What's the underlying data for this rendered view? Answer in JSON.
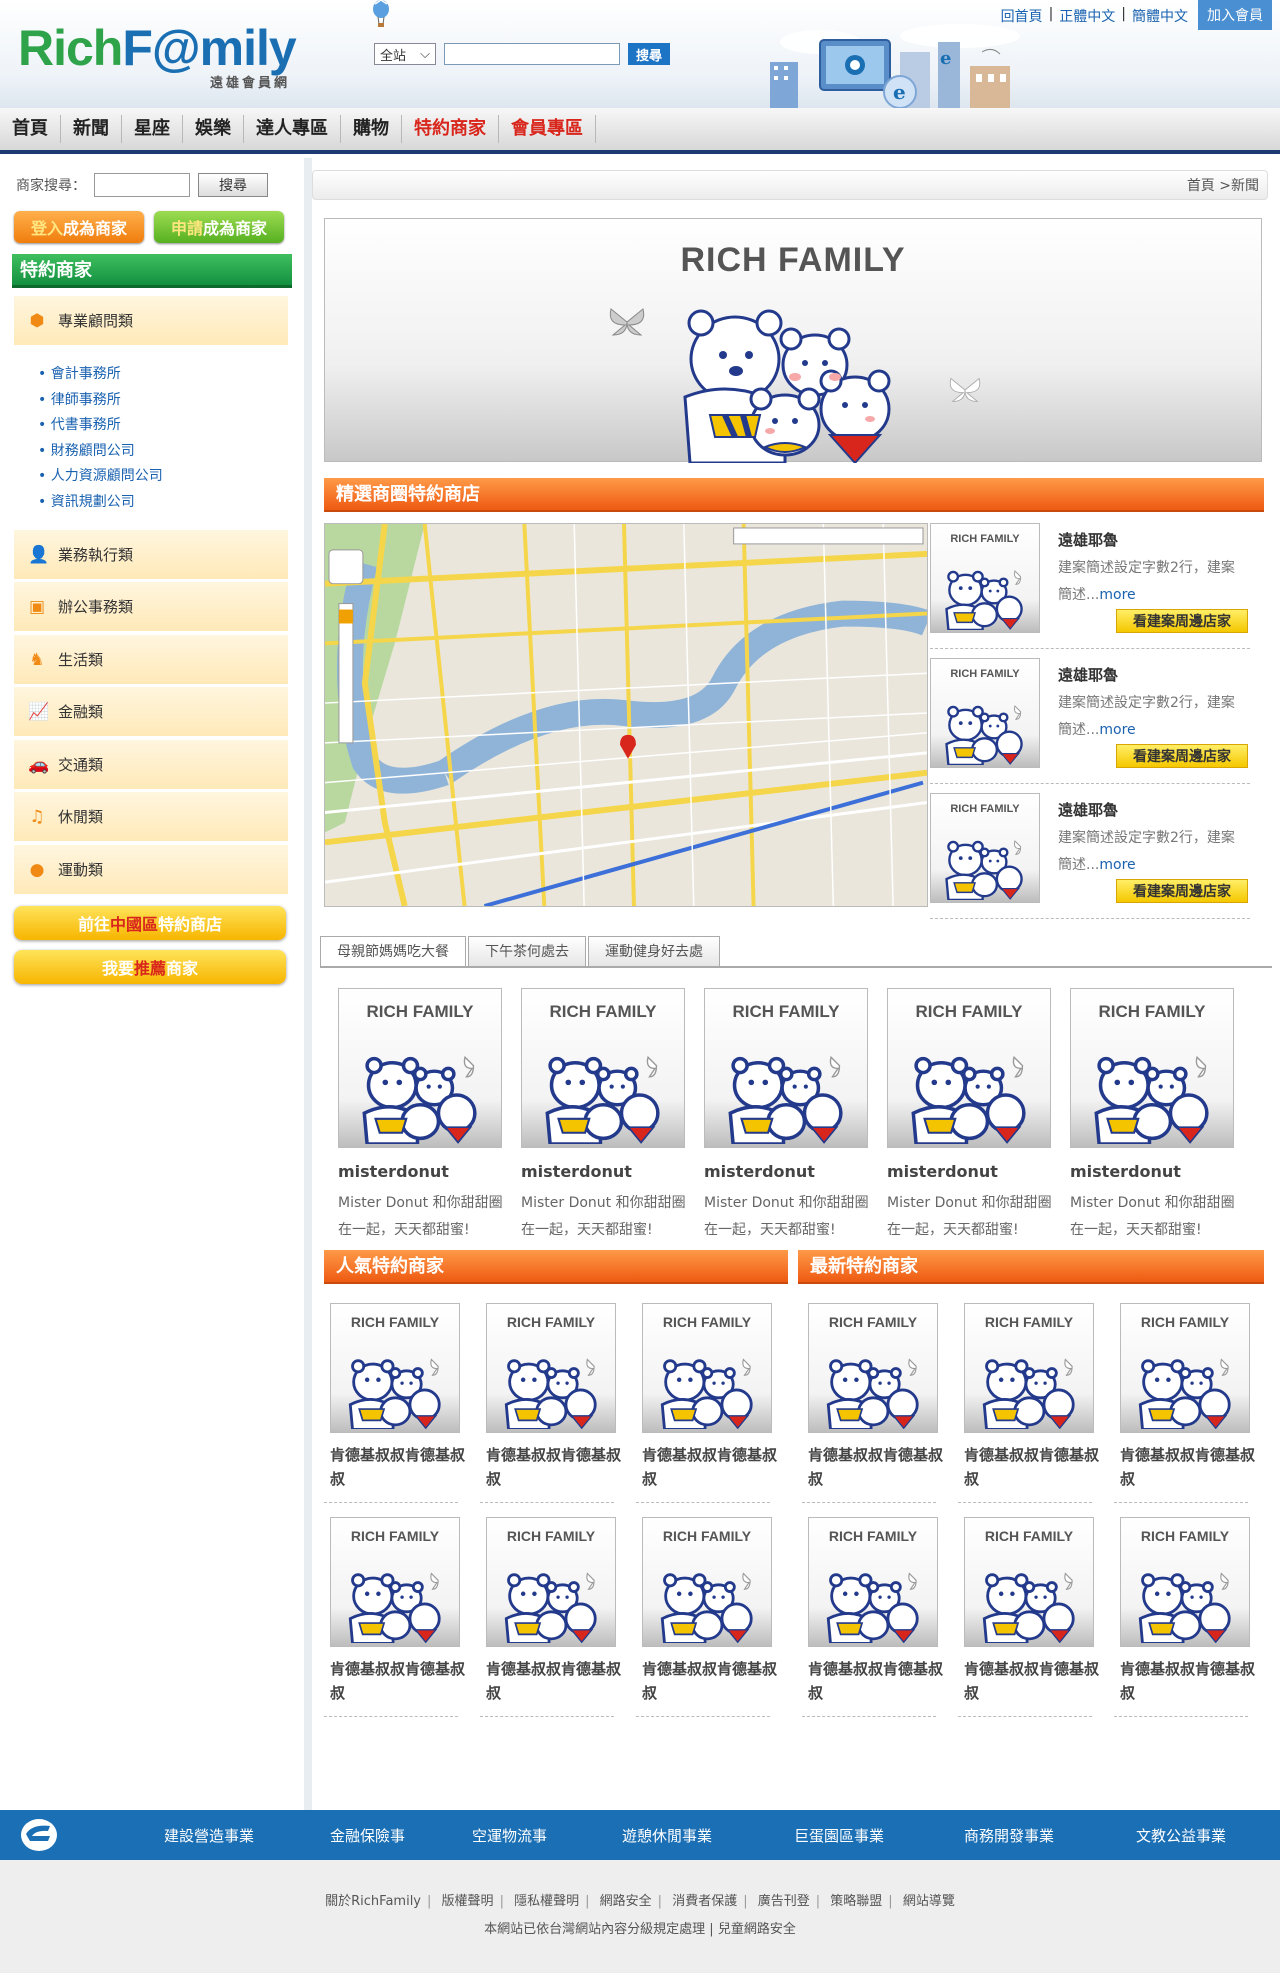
{
  "header": {
    "logo_part1": "Rich",
    "logo_part2": "F@mily",
    "logo_sub": "遠雄會員網",
    "site_select": "全站",
    "search_button": "搜尋",
    "top_links": [
      "回首頁",
      "正體中文",
      "簡體中文"
    ],
    "join_button": "加入會員"
  },
  "nav": {
    "items": [
      {
        "label": "首頁",
        "highlight": false
      },
      {
        "label": "新聞",
        "highlight": false
      },
      {
        "label": "星座",
        "highlight": false
      },
      {
        "label": "娛樂",
        "highlight": false
      },
      {
        "label": "達人專區",
        "highlight": false
      },
      {
        "label": "購物",
        "highlight": false
      },
      {
        "label": "特約商家",
        "highlight": true
      },
      {
        "label": "會員專區",
        "highlight": true
      }
    ]
  },
  "sidebar": {
    "search_label": "商家搜尋：",
    "search_button": "搜尋",
    "login_cta": {
      "hl": "登入",
      "rest": "成為商家"
    },
    "apply_cta": {
      "hl": "申請",
      "rest": "成為商家"
    },
    "title": "特約商家",
    "categories": [
      {
        "label": "專業顧問類",
        "icon": "cube-icon"
      },
      {
        "label": "業務執行類",
        "icon": "person-icon"
      },
      {
        "label": "辦公事務類",
        "icon": "briefcase-icon"
      },
      {
        "label": "生活類",
        "icon": "dog-icon"
      },
      {
        "label": "金融類",
        "icon": "chart-icon"
      },
      {
        "label": "交通類",
        "icon": "car-icon"
      },
      {
        "label": "休閒類",
        "icon": "music-icon"
      },
      {
        "label": "運動類",
        "icon": "ball-icon"
      }
    ],
    "sub_items": [
      "會計事務所",
      "律師事務所",
      "代書事務所",
      "財務顧問公司",
      "人力資源顧問公司",
      "資訊規劃公司"
    ],
    "china_btn": {
      "pre": "前往",
      "hl": "中國區",
      "post": "特約商店"
    },
    "recommend_btn": {
      "pre": "我要",
      "hl": "推薦",
      "post": "商家"
    }
  },
  "main": {
    "breadcrumb": "首頁 >新聞",
    "banner_title": "RICH FAMILY",
    "featured_title": "精選商圈特約商店",
    "thumb_text": "RICH FAMILY",
    "stores": [
      {
        "name": "遠雄耶魯",
        "desc": "建案簡述設定字數2行，建案簡述...",
        "more": "more",
        "button": "看建案周邊店家"
      },
      {
        "name": "遠雄耶魯",
        "desc": "建案簡述設定字數2行，建案簡述...",
        "more": "more",
        "button": "看建案周邊店家"
      },
      {
        "name": "遠雄耶魯",
        "desc": "建案簡述設定字數2行，建案簡述...",
        "more": "more",
        "button": "看建案周邊店家"
      }
    ],
    "tabs": [
      "母親節媽媽吃大餐",
      "下午茶何處去",
      "運動健身好去處"
    ],
    "products": [
      {
        "name": "misterdonut",
        "desc": "Mister Donut 和你甜甜圈 在一起，天天都甜蜜!"
      },
      {
        "name": "misterdonut",
        "desc": "Mister Donut 和你甜甜圈 在一起，天天都甜蜜!"
      },
      {
        "name": "misterdonut",
        "desc": "Mister Donut 和你甜甜圈 在一起，天天都甜蜜!"
      },
      {
        "name": "misterdonut",
        "desc": "Mister Donut 和你甜甜圈 在一起，天天都甜蜜!"
      },
      {
        "name": "misterdonut",
        "desc": "Mister Donut 和你甜甜圈 在一起，天天都甜蜜!"
      }
    ],
    "popular_title": "人氣特約商家",
    "newest_title": "最新特約商家",
    "popular_items": [
      "肯德基叔叔肯德基叔叔",
      "肯德基叔叔肯德基叔叔",
      "肯德基叔叔肯德基叔叔",
      "肯德基叔叔肯德基叔叔",
      "肯德基叔叔肯德基叔叔",
      "肯德基叔叔肯德基叔叔"
    ],
    "newest_items": [
      "肯德基叔叔肯德基叔叔",
      "肯德基叔叔肯德基叔叔",
      "肯德基叔叔肯德基叔叔",
      "肯德基叔叔肯德基叔叔",
      "肯德基叔叔肯德基叔叔",
      "肯德基叔叔肯德基叔叔"
    ]
  },
  "footer": {
    "categories": [
      "建設營造事業",
      "金融保險事",
      "空運物流事",
      "遊憩休閒事業",
      "巨蛋園區事業",
      "商務開發事業",
      "文教公益事業"
    ],
    "links": [
      "關於RichFamily",
      "版權聲明",
      "隱私權聲明",
      "網路安全",
      "消費者保護",
      "廣告刊登",
      "策略聯盟",
      "網站導覽"
    ],
    "note": "本網站已依台灣網站內容分級規定處理 | 兒童網路安全"
  },
  "colors": {
    "brand_green": "#2ea34a",
    "brand_blue": "#1a6fb3",
    "section_orange": "#ee5a12",
    "footer_blue": "#1a6fb5",
    "nav_red": "#d9261c"
  }
}
